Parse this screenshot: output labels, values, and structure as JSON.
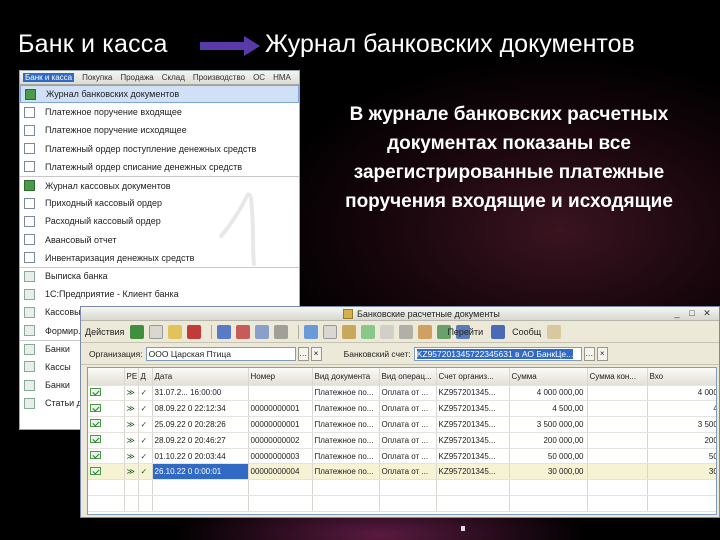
{
  "slide": {
    "title_left": "Банк и касса",
    "title_right": "Журнал банковских документов",
    "description": "В журнале банковских расчетных документах показаны все зарегистрированные платежные поручения входящие и исходящие"
  },
  "menu": {
    "bar": [
      "Банк и касса",
      "Покупка",
      "Продажа",
      "Склад",
      "Производство",
      "ОС",
      "НМА"
    ],
    "items": [
      {
        "label": "Журнал банковских документов",
        "icon": "journal-icon",
        "selected": true
      },
      {
        "label": "Платежное поручение входящее",
        "icon": "document-icon"
      },
      {
        "label": "Платежное поручение исходящее",
        "icon": "document-icon"
      },
      {
        "label": "Платежный ордер поступление денежных средств",
        "icon": "document-icon"
      },
      {
        "label": "Платежный ордер списание денежных средств",
        "icon": "document-icon"
      },
      {
        "label": "Журнал кассовых документов",
        "icon": "journal-icon"
      },
      {
        "label": "Приходный кассовый ордер",
        "icon": "document-icon"
      },
      {
        "label": "Расходный кассовый ордер",
        "icon": "document-icon"
      },
      {
        "label": "Авансовый отчет",
        "icon": "document-icon"
      },
      {
        "label": "Инвентаризация денежных средств",
        "icon": "document-icon"
      },
      {
        "label": "Выписка банка",
        "icon": "bank-statement-icon"
      },
      {
        "label": "1С:Предприятие - Клиент банка",
        "icon": "client-bank-icon"
      },
      {
        "label": "Кассовые ...",
        "icon": "cash-icon"
      },
      {
        "label": "Формир...",
        "icon": "form-icon"
      },
      {
        "label": "Банки",
        "icon": "bank-icon"
      },
      {
        "label": "Кассы",
        "icon": "cashbox-icon"
      },
      {
        "label": "Банки",
        "icon": "bank-icon"
      },
      {
        "label": "Статьи дв...",
        "icon": "article-icon"
      }
    ]
  },
  "journal": {
    "window_title": "Банковские расчетные документы",
    "toolbar": {
      "actions": "Действия",
      "go": "Перейти",
      "help": "Сообщ"
    },
    "filters": {
      "org_label": "Организация:",
      "org_value": "ООО Царская Птица",
      "account_label": "Банковский счет:",
      "account_value": "KZ957201345722345631 в АО БанкЦе..."
    },
    "columns": [
      "",
      "РЕ",
      "Д",
      "Дата",
      "Номер",
      "Вид документа",
      "Вид операц...",
      "Счет организ...",
      "Сумма",
      "Сумма кон...",
      "Вхо"
    ],
    "rows": [
      {
        "date": "31.07.2... 16:00:00",
        "number": "",
        "doc": "Платежное по...",
        "op": "Оплата от ...",
        "account": "KZ957201345...",
        "sum": "4 000 000,00",
        "sum2": "",
        "in": "4 000 0"
      },
      {
        "date": "08.09.22 0 22:12:34",
        "number": "00000000001",
        "doc": "Платежное по...",
        "op": "Оплата от ...",
        "account": "KZ957201345...",
        "sum": "4 500,00",
        "sum2": "",
        "in": "4 5"
      },
      {
        "date": "25.09.22 0 20:28:26",
        "number": "00000000001",
        "doc": "Платежное по...",
        "op": "Оплата от ...",
        "account": "KZ957201345...",
        "sum": "3 500 000,00",
        "sum2": "",
        "in": "3 500 0"
      },
      {
        "date": "28.09.22 0 20:46:27",
        "number": "00000000002",
        "doc": "Платежное по...",
        "op": "Оплата от ...",
        "account": "KZ957201345...",
        "sum": "200 000,00",
        "sum2": "",
        "in": "200 0"
      },
      {
        "date": "01.10.22 0 20:03:44",
        "number": "00000000003",
        "doc": "Платежное по...",
        "op": "Оплата от ...",
        "account": "KZ957201345...",
        "sum": "50 000,00",
        "sum2": "",
        "in": "50 0"
      },
      {
        "date": "26.10.22 0 0:00:01",
        "number": "00000000004",
        "doc": "Платежное по...",
        "op": "Оплата от ...",
        "account": "KZ957201345...",
        "sum": "30 000,00",
        "sum2": "",
        "in": "30 0",
        "selected": true
      }
    ]
  },
  "colors": {
    "accent": "#316ac5",
    "selected_row": "#f6f2d4",
    "menu_selection": "#cfe0f7"
  }
}
